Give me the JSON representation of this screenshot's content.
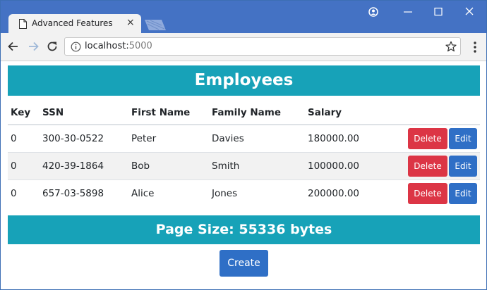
{
  "browser": {
    "tab_title": "Advanced Features",
    "tab_close_glyph": "×",
    "url_host": "localhost:",
    "url_port": "5000"
  },
  "page": {
    "heading": "Employees",
    "columns": [
      "Key",
      "SSN",
      "First Name",
      "Family Name",
      "Salary"
    ],
    "rows": [
      {
        "key": "0",
        "ssn": "300-30-0522",
        "first": "Peter",
        "family": "Davies",
        "salary": "180000.00"
      },
      {
        "key": "0",
        "ssn": "420-39-1864",
        "first": "Bob",
        "family": "Smith",
        "salary": "100000.00"
      },
      {
        "key": "0",
        "ssn": "657-03-5898",
        "first": "Alice",
        "family": "Jones",
        "salary": "200000.00"
      }
    ],
    "delete_label": "Delete",
    "edit_label": "Edit",
    "page_size_text": "Page Size: 55336 bytes",
    "create_label": "Create"
  },
  "colors": {
    "banner": "#17a2b8",
    "delete_button": "#dc3545",
    "edit_button": "#2f6fc6",
    "titlebar": "#4472c4"
  },
  "icons": [
    "page-icon",
    "close-icon",
    "new-tab-icon",
    "profile-icon",
    "minimize-icon",
    "maximize-icon",
    "close-window-icon",
    "back-icon",
    "forward-icon",
    "reload-icon",
    "info-icon",
    "star-icon",
    "menu-icon"
  ]
}
